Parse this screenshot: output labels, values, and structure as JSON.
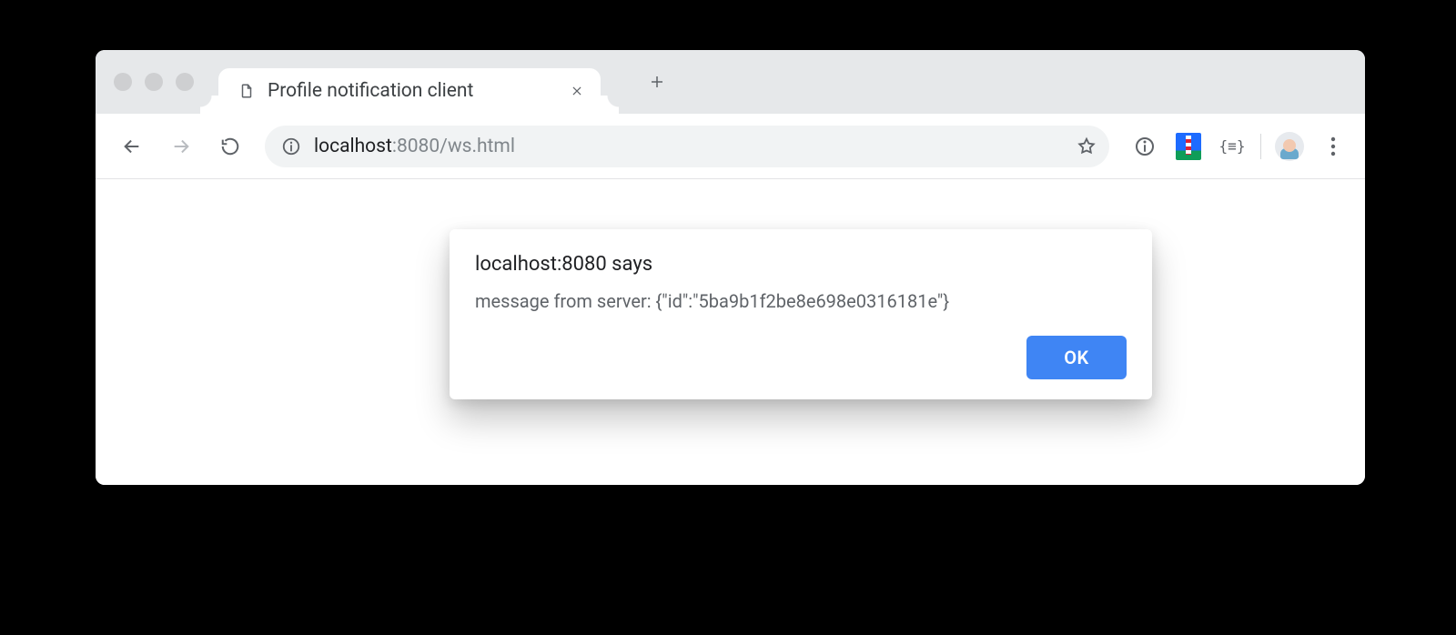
{
  "tab": {
    "title": "Profile notification client"
  },
  "url": {
    "host": "localhost",
    "port_path": ":8080/ws.html"
  },
  "alert": {
    "title": "localhost:8080 says",
    "message": "message from server: {\"id\":\"5ba9b1f2be8e698e0316181e\"}",
    "ok_label": "OK"
  },
  "ext": {
    "code_glyph": "{≡}"
  }
}
